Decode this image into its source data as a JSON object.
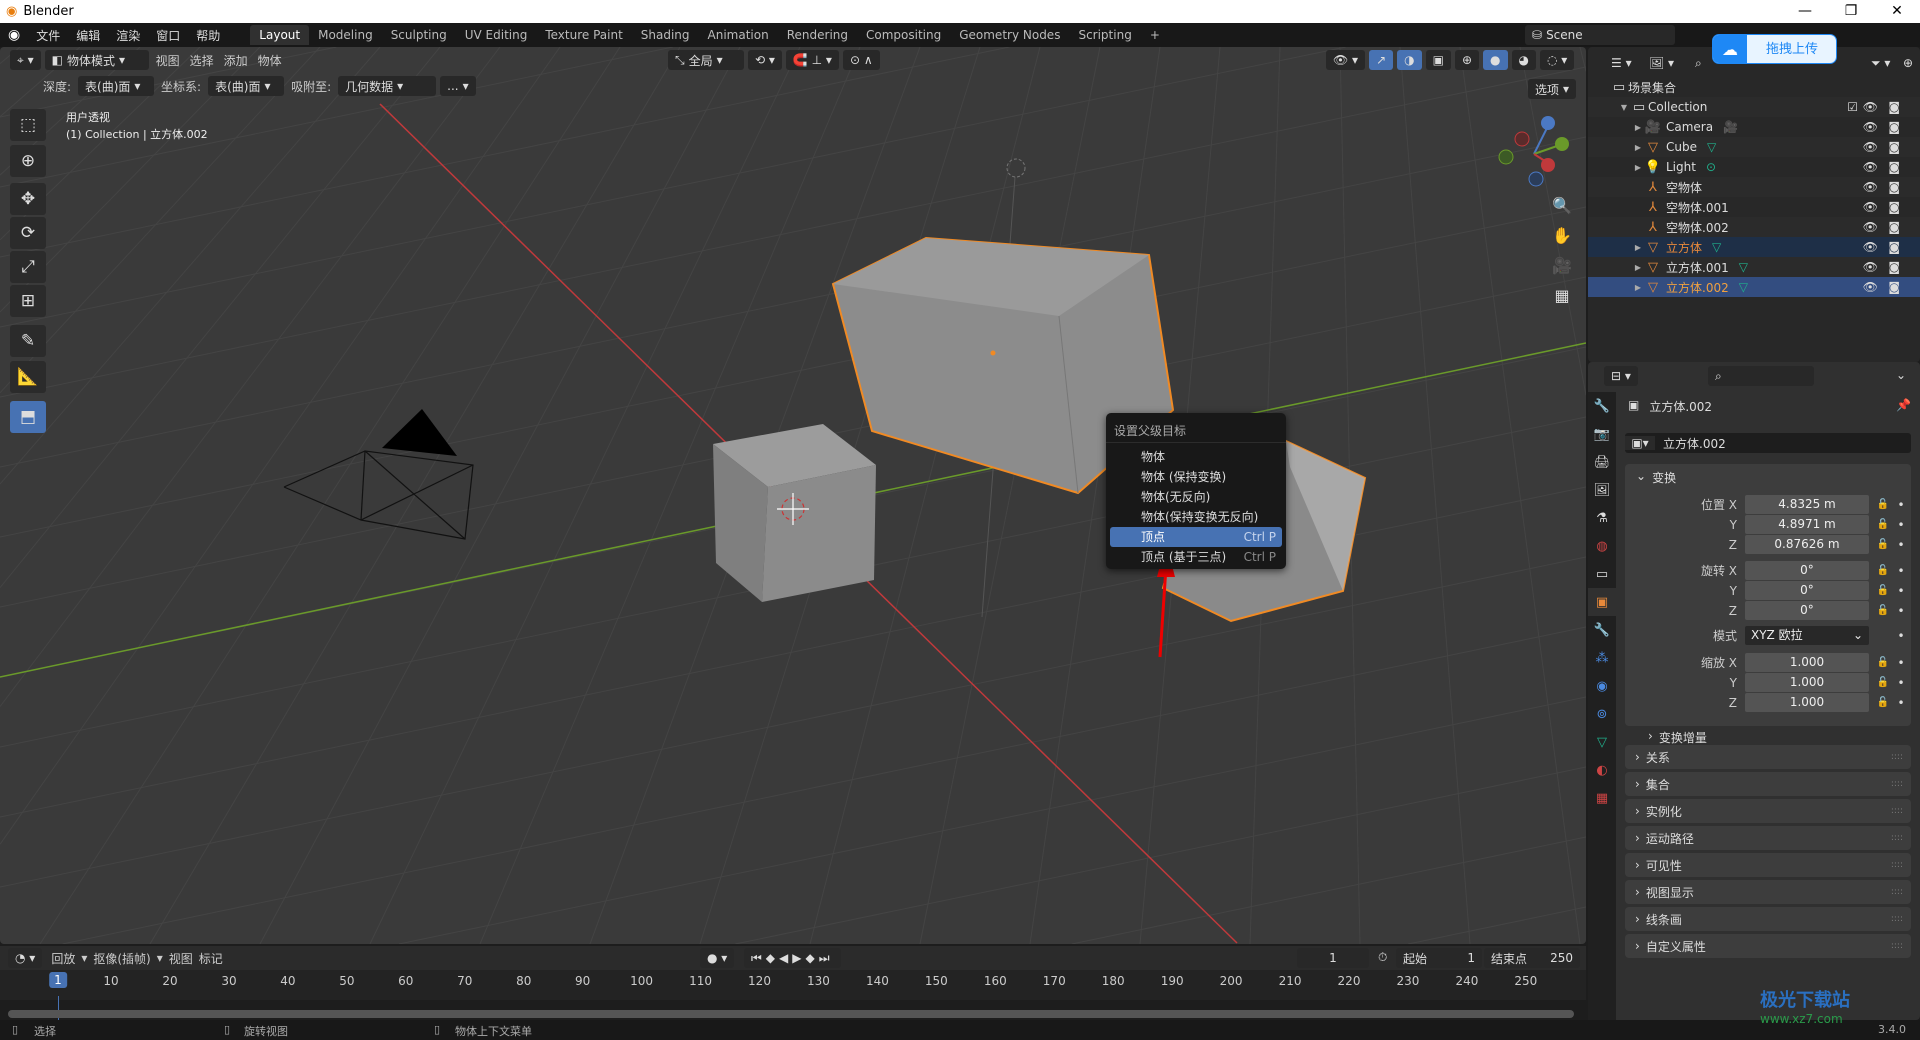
{
  "window": {
    "title": "Blender",
    "controls": [
      "—",
      "❐",
      "✕"
    ]
  },
  "menu": [
    "文件",
    "编辑",
    "渲染",
    "窗口",
    "帮助"
  ],
  "workspaces": [
    "Layout",
    "Modeling",
    "Sculpting",
    "UV Editing",
    "Texture Paint",
    "Shading",
    "Animation",
    "Rendering",
    "Compositing",
    "Geometry Nodes",
    "Scripting",
    "+"
  ],
  "scene": "Scene",
  "viewport": {
    "mode": "物体模式",
    "menus": [
      "视图",
      "选择",
      "添加",
      "物体"
    ],
    "transform_orientation": "全局",
    "tool_settings": {
      "depth_label": "深度:",
      "depth": "表(曲)面",
      "orient_label": "坐标系:",
      "orient": "表(曲)面",
      "snap_label": "吸附至:",
      "snap": "几何数据",
      "more": "...",
      "options": "选项"
    },
    "overlay_text": {
      "view": "用户透视",
      "collection": "(1) Collection | 立方体.002"
    }
  },
  "context_menu": {
    "title": "设置父级目标",
    "items": [
      {
        "label": "物体",
        "shortcut": ""
      },
      {
        "label": "物体 (保持变换)",
        "shortcut": ""
      },
      {
        "label": "物体(无反向)",
        "shortcut": ""
      },
      {
        "label": "物体(保持变换无反向)",
        "shortcut": ""
      },
      {
        "label": "顶点",
        "shortcut": "Ctrl P",
        "selected": true
      },
      {
        "label": "顶点 (基于三点)",
        "shortcut": "Ctrl P"
      }
    ]
  },
  "upload_button": "拖拽上传",
  "outliner": {
    "root": "场景集合",
    "collection": "Collection",
    "items": [
      {
        "name": "Camera",
        "icon": "camera-icon",
        "expand": true
      },
      {
        "name": "Cube",
        "icon": "mesh-icon",
        "expand": true
      },
      {
        "name": "Light",
        "icon": "light-icon",
        "expand": true
      },
      {
        "name": "空物体",
        "icon": "empty-icon",
        "expand": false
      },
      {
        "name": "空物体.001",
        "icon": "empty-icon",
        "expand": false
      },
      {
        "name": "空物体.002",
        "icon": "empty-icon",
        "expand": false
      },
      {
        "name": "立方体",
        "icon": "mesh-icon",
        "expand": true,
        "state": "selected"
      },
      {
        "name": "立方体.001",
        "icon": "mesh-icon",
        "expand": true
      },
      {
        "name": "立方体.002",
        "icon": "mesh-icon",
        "expand": true,
        "state": "active"
      }
    ]
  },
  "properties": {
    "object_name": "立方体.002",
    "datablock": "立方体.002",
    "transform_label": "变换",
    "location": {
      "label": "位置",
      "x": "4.8325 m",
      "y": "4.8971 m",
      "z": "0.87626 m"
    },
    "rotation": {
      "label": "旋转",
      "x": "0°",
      "y": "0°",
      "z": "0°"
    },
    "mode": {
      "label": "模式",
      "value": "XYZ 欧拉"
    },
    "scale": {
      "label": "缩放",
      "x": "1.000",
      "y": "1.000",
      "z": "1.000"
    },
    "delta": "变换增量",
    "panels": [
      "关系",
      "集合",
      "实例化",
      "运动路径",
      "可见性",
      "视图显示",
      "线条画",
      "自定义属性"
    ]
  },
  "timeline": {
    "menus": [
      "回放",
      "抠像(插帧)",
      "视图",
      "标记"
    ],
    "current_frame": "1",
    "start_label": "起始",
    "start": "1",
    "end_label": "结束点",
    "end": "250",
    "ticks": [
      "1",
      "10",
      "20",
      "30",
      "40",
      "50",
      "60",
      "70",
      "80",
      "90",
      "100",
      "110",
      "120",
      "130",
      "140",
      "150",
      "160",
      "170",
      "180",
      "190",
      "200",
      "210",
      "220",
      "230",
      "240",
      "250"
    ]
  },
  "statusbar": {
    "left": "选择",
    "middle": "旋转视图",
    "right": "物体上下文菜单",
    "version": "3.4.0"
  },
  "watermark": {
    "name": "极光下载站",
    "url": "www.xz7.com"
  },
  "colors": {
    "accent": "#4772b3",
    "selected_outline": "#f08a24",
    "x_axis": "#c0393b",
    "y_axis": "#6a9a2a"
  }
}
